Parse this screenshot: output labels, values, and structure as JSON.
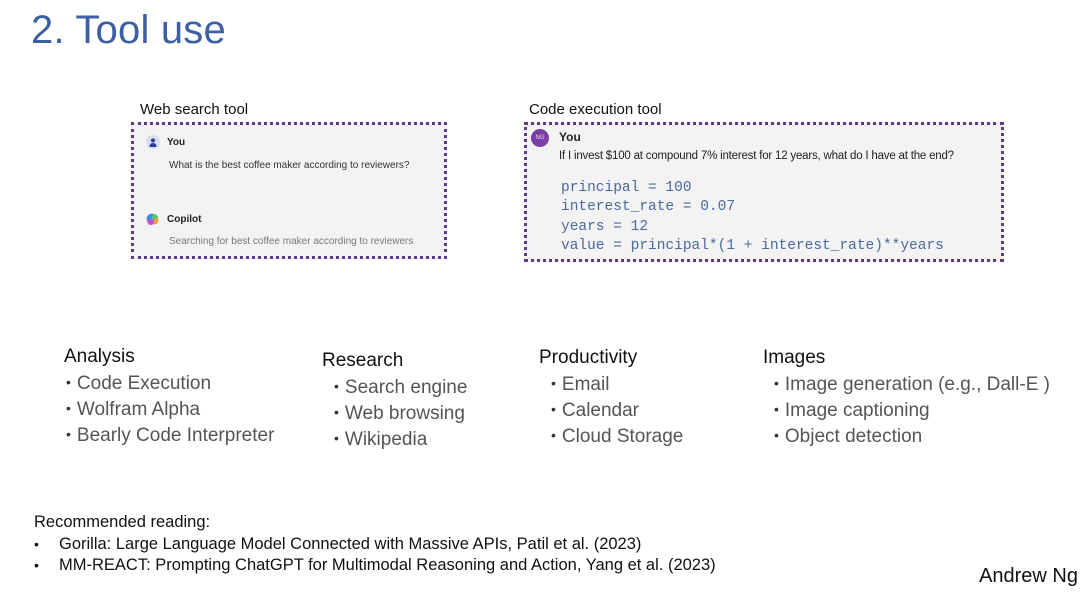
{
  "slide": {
    "title": "2. Tool use",
    "author": "Andrew Ng"
  },
  "web_search_tool": {
    "label": "Web search tool",
    "user_name": "You",
    "user_message": "What is the best coffee maker according to reviewers?",
    "assistant_name": "Copilot",
    "assistant_status": "Searching for best coffee maker according to reviewers",
    "border_color": "#5b3a8c"
  },
  "code_execution_tool": {
    "label": "Code execution tool",
    "avatar_initials": "NG",
    "user_name": "You",
    "user_message": "If I invest $100 at compound 7% interest for 12 years, what do I have at the end?",
    "code_lines": [
      "principal = 100",
      "interest_rate = 0.07",
      "years = 12",
      "value = principal*(1 + interest_rate)**years"
    ],
    "border_color": "#5b3a8c"
  },
  "categories": [
    {
      "title": "Analysis",
      "items": [
        "Code Execution",
        "Wolfram Alpha",
        "Bearly Code Interpreter"
      ]
    },
    {
      "title": "Research",
      "items": [
        "Search engine",
        "Web browsing",
        "Wikipedia"
      ]
    },
    {
      "title": "Productivity",
      "items": [
        "Email",
        "Calendar",
        "Cloud Storage"
      ]
    },
    {
      "title": "Images",
      "items": [
        "Image generation (e.g., Dall-E )",
        "Image captioning",
        "Object detection"
      ]
    }
  ],
  "recommended_reading": {
    "heading": "Recommended reading:",
    "items": [
      "Gorilla: Large Language Model Connected with Massive APIs, Patil et al. (2023)",
      "MM-REACT: Prompting ChatGPT for Multimodal Reasoning and Action, Yang et al. (2023)"
    ],
    "bullet": "•"
  },
  "bullet_glyph": "•",
  "colors": {
    "title": "#3d5fa3",
    "code": "#4a6a9e",
    "panel_bg": "#f3f3f3",
    "avatar_ng": "#7a3fa8"
  }
}
